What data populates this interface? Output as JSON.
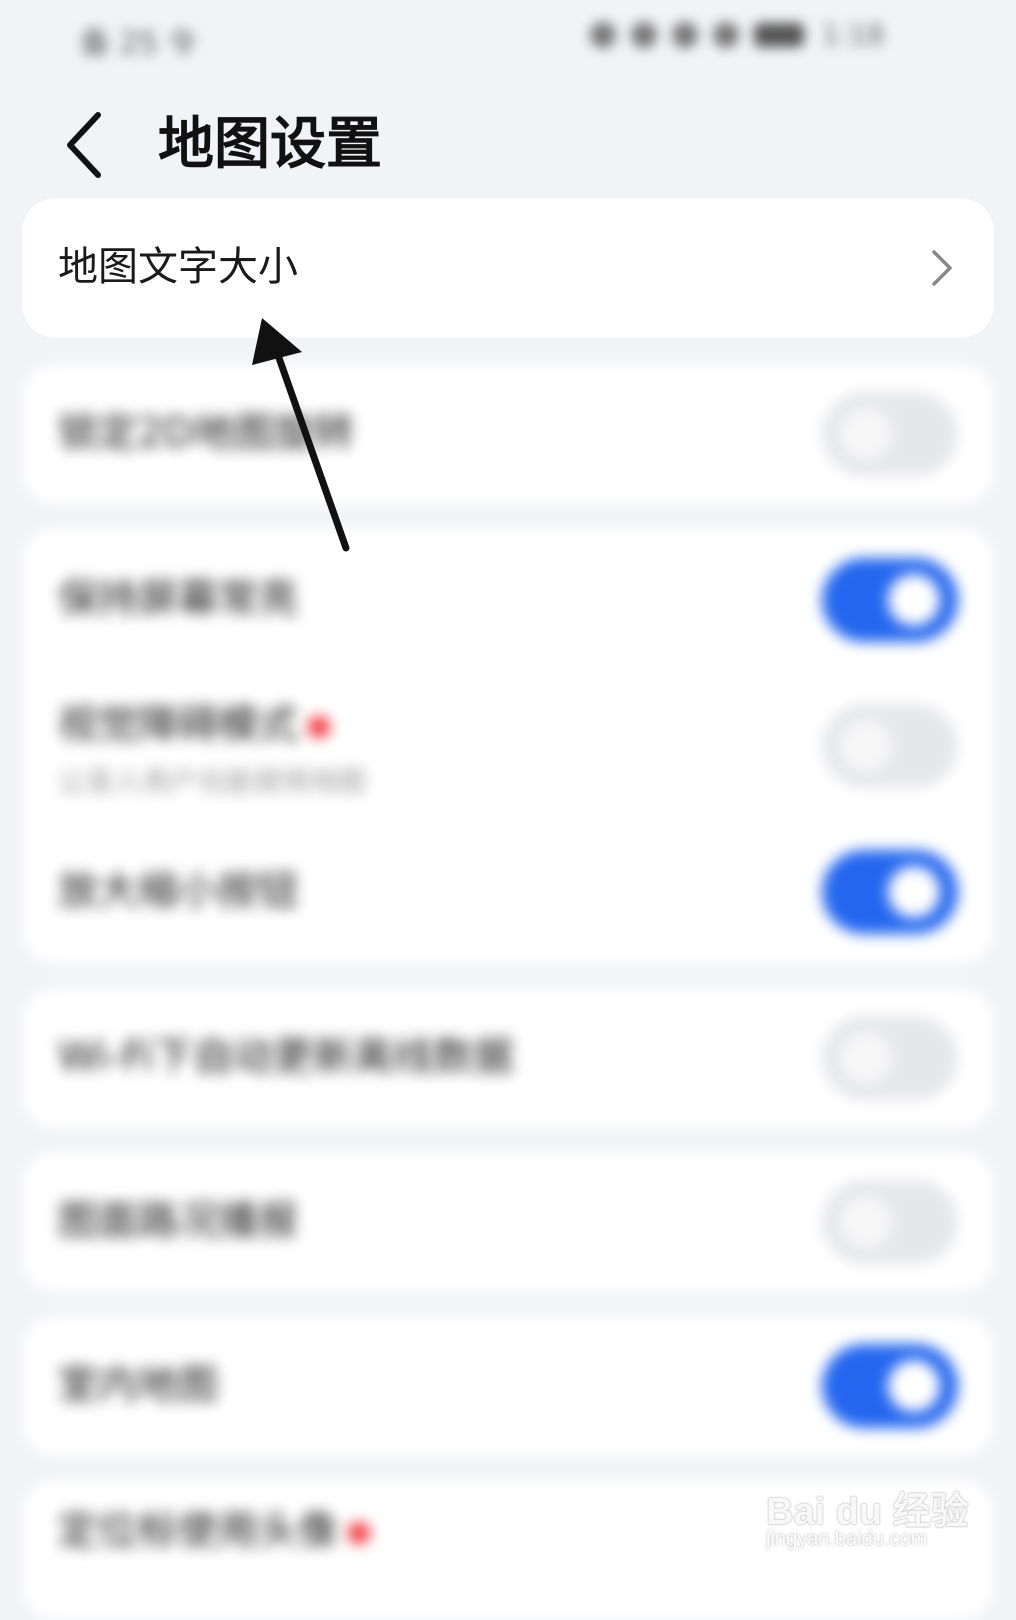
{
  "status_bar": {
    "left_text": "备 25 令",
    "right_text": "1:18"
  },
  "header": {
    "title": "地图设置"
  },
  "settings": [
    {
      "label": "地图文字大小",
      "type": "link"
    },
    {
      "label": "锁定2D地图旋转",
      "type": "toggle",
      "on": false
    },
    {
      "label": "保持屏幕常亮",
      "type": "toggle",
      "on": true
    },
    {
      "label": "视觉障碍模式",
      "sub": "让盲人用户也能使用地图",
      "type": "toggle",
      "on": false,
      "badge": "red-dot"
    },
    {
      "label": "放大缩小按钮",
      "type": "toggle",
      "on": true
    },
    {
      "label": "Wi-Fi下自动更新离线数据",
      "type": "toggle",
      "on": false
    },
    {
      "label": "图面路况播报",
      "type": "toggle",
      "on": false
    },
    {
      "label": "室内地图",
      "type": "toggle",
      "on": true
    },
    {
      "label": "定位标使用头像",
      "type": "toggle",
      "badge": "red-dot"
    }
  ],
  "watermark": {
    "main": "Bai du 经验",
    "sub": "jingyan.baidu.com"
  },
  "colors": {
    "accent": "#2467ee",
    "background": "#f2f3f6",
    "card": "#ffffff",
    "badge": "#f0343a"
  },
  "icons": {
    "back": "chevron-left-icon",
    "link": "chevron-right-icon",
    "annotation": "arrow-annotation-icon"
  }
}
